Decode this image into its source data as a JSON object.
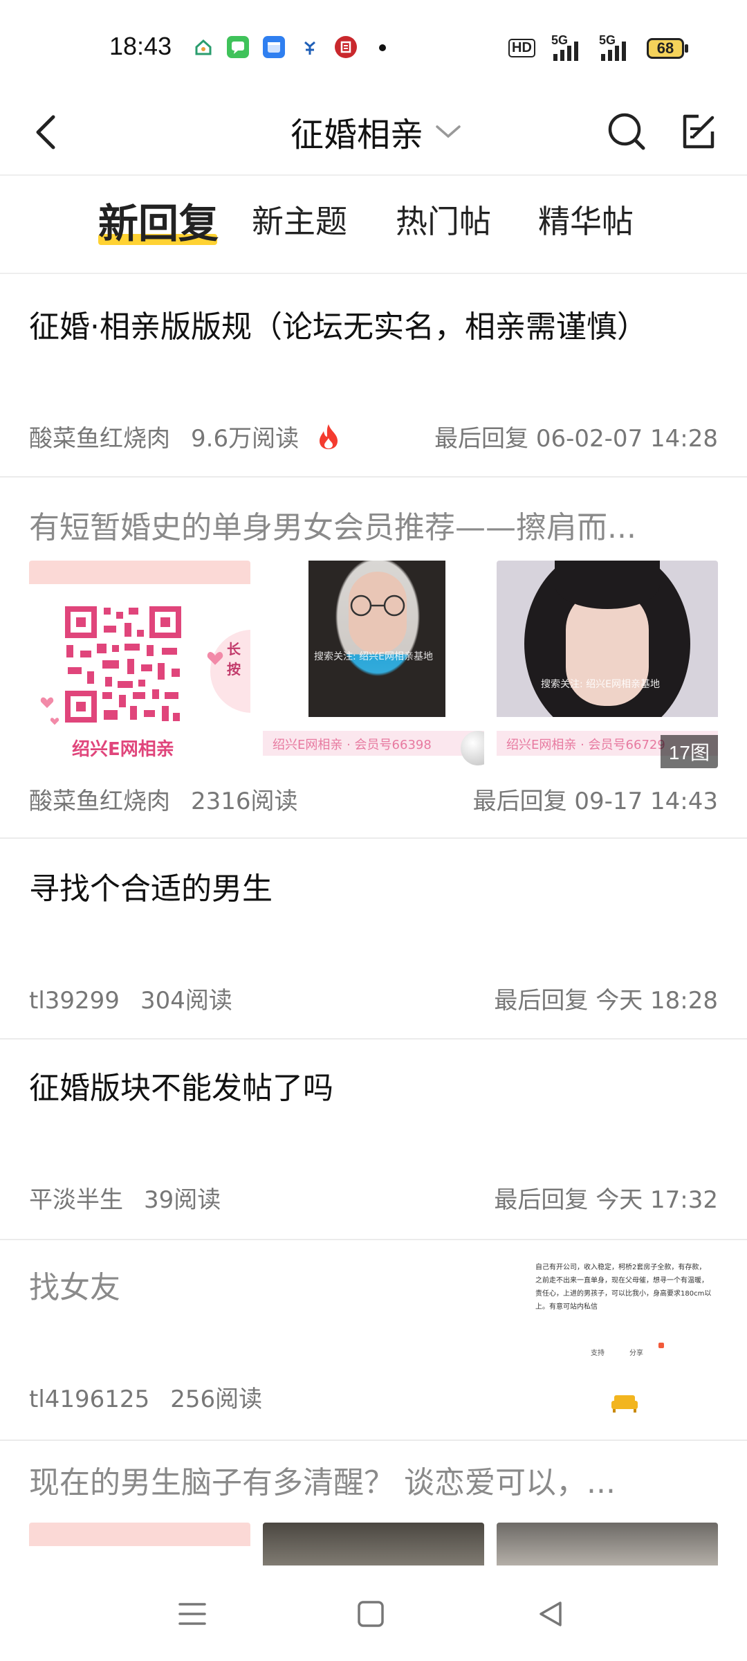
{
  "status_bar": {
    "time": "18:43",
    "hd_label": "HD",
    "signal1": "5G",
    "signal2": "5G",
    "battery": "68",
    "app_icons": [
      "home-app-icon",
      "chat-app-icon",
      "files-app-icon",
      "bank-app-icon",
      "railway-app-icon"
    ]
  },
  "header": {
    "title": "征婚相亲",
    "back_icon": "chevron-left-icon",
    "dropdown_icon": "chevron-down-icon",
    "search_icon": "search-icon",
    "compose_icon": "compose-icon"
  },
  "tabs": [
    {
      "label": "新回复",
      "active": true
    },
    {
      "label": "新主题",
      "active": false
    },
    {
      "label": "热门帖",
      "active": false
    },
    {
      "label": "精华帖",
      "active": false
    }
  ],
  "posts": [
    {
      "title": "征婚·相亲版版规（论坛无实名，相亲需谨慎）",
      "author": "酸菜鱼红烧肉",
      "reads": "9.6万阅读",
      "hot": true,
      "last_reply": "最后回复 06-02-07 14:28"
    },
    {
      "title": "有短暂婚史的单身男女会员推荐——擦肩而...",
      "author": "酸菜鱼红烧肉",
      "reads": "2316阅读",
      "last_reply": "最后回复 09-17 14:43",
      "thumb1_text": "绍兴E网相亲",
      "thumb1_side": "长按",
      "thumb2_caption": "绍兴E网相亲 · 会员号66398",
      "thumb3_caption": "绍兴E网相亲 · 会员号66729",
      "watermark": "搜索关注: 绍兴E网相亲基地",
      "image_count": "17图"
    },
    {
      "title": "寻找个合适的男生",
      "author": "tl39299",
      "reads": "304阅读",
      "last_reply": "最后回复 今天 18:28"
    },
    {
      "title": "征婚版块不能发帖了吗",
      "author": "平淡半生",
      "reads": "39阅读",
      "last_reply": "最后回复 今天 17:32"
    },
    {
      "title": "找女友",
      "author": "tl4196125",
      "reads": "256阅读",
      "thumb_text": "自己有开公司，收入稳定，柯桥2套房子全款，有存款，之前走不出来一直单身，现在父母催，想寻一个有温暖，责任心，上进的男孩子，可以比我小，身高要求180cm以上。有意可站内私信",
      "thumb_support": "支持",
      "thumb_share": "分享"
    },
    {
      "title": "现在的男生脑子有多清醒？ 谈恋爱可以，..."
    }
  ],
  "nav": {
    "menu_icon": "menu-icon",
    "home_icon": "square-home-icon",
    "back_icon": "triangle-back-icon"
  }
}
